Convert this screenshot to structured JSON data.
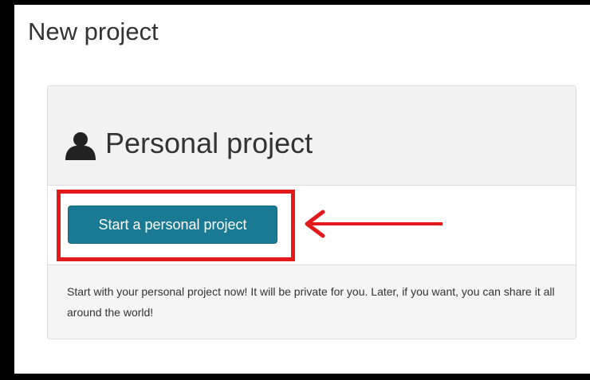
{
  "page": {
    "title": "New project"
  },
  "panel": {
    "icon": "user-icon",
    "title": "Personal project",
    "button_label": "Start a personal project",
    "description": "Start with your personal project now! It will be private for you. Later, if you want, you can share it all around the world!"
  },
  "annotation": {
    "highlight_color": "#e31a1c",
    "arrow_icon": "left-arrow-icon"
  },
  "colors": {
    "button_bg": "#1b7a93",
    "panel_heading_bg": "#f2f2f2",
    "panel_footer_bg": "#f5f5f5"
  }
}
